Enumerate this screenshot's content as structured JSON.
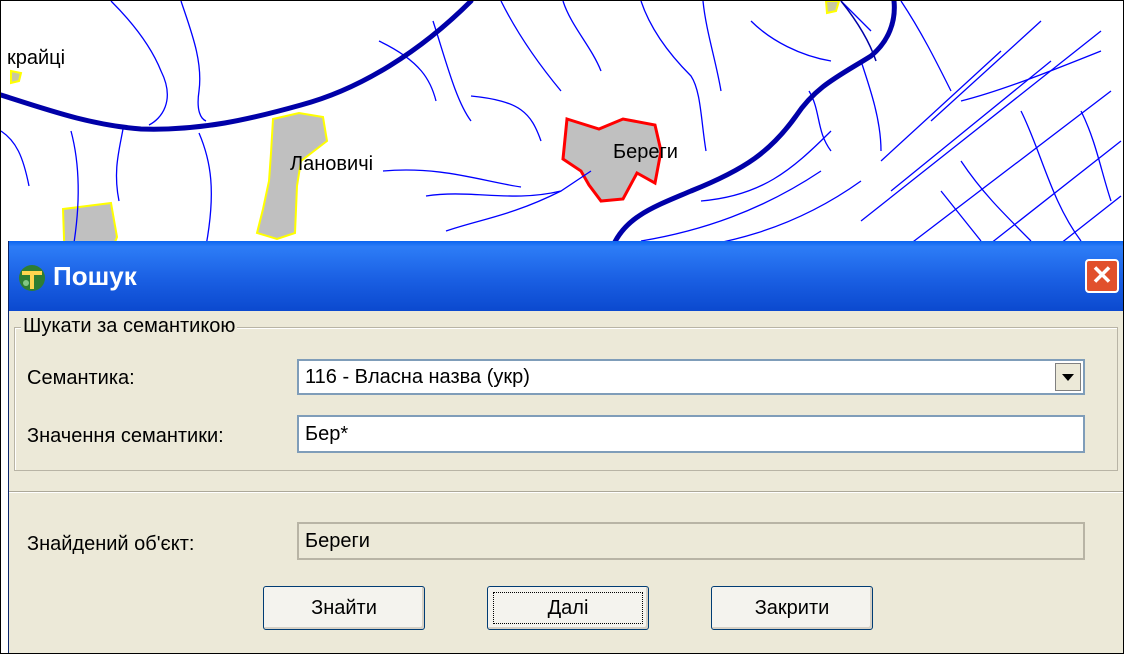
{
  "map": {
    "labels": {
      "kraytsi": "крайці",
      "lanovychi": "Лановичі",
      "berehy": "Береги"
    }
  },
  "dialog": {
    "title": "Пошук",
    "close_glyph": "✕",
    "group_title": "Шукати за семантикою",
    "semantic_label": "Семантика:",
    "semantic_value": "116 - Власна назва (укр)",
    "value_label": "Значення семантики:",
    "value_input": "Бер*",
    "found_label": "Знайдений об'єкт:",
    "found_value": "Береги",
    "buttons": {
      "find": "Знайти",
      "next": "Далі",
      "close": "Закрити"
    }
  },
  "colors": {
    "river_major": "#0000a8",
    "stream": "#0000ff",
    "settlement_fill": "#c0c0c0",
    "settlement_border": "#ffff00",
    "selected_border": "#ff0000",
    "titlebar": "#0a58e6"
  }
}
